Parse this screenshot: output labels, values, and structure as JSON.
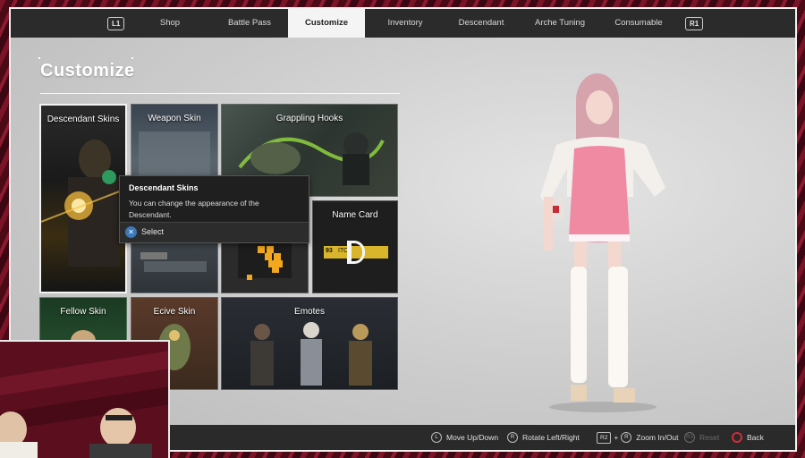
{
  "nav": {
    "left_key": "L1",
    "right_key": "R1",
    "tabs": [
      {
        "label": "Shop"
      },
      {
        "label": "Battle Pass"
      },
      {
        "label": "Customize"
      },
      {
        "label": "Inventory"
      },
      {
        "label": "Descendant"
      },
      {
        "label": "Arche Tuning"
      },
      {
        "label": "Consumable"
      }
    ],
    "active_tab": "Customize"
  },
  "page": {
    "title": "Customize"
  },
  "tiles": [
    {
      "label": "Descendant Skins"
    },
    {
      "label": "Weapon Skin"
    },
    {
      "label": "Grappling Hooks"
    },
    {
      "label": "Name Card"
    },
    {
      "label": "Fellow Skin"
    },
    {
      "label": "Ecive Skin"
    },
    {
      "label": "Emotes"
    }
  ],
  "name_card_preview": {
    "level": "93",
    "tag": "ITO"
  },
  "tooltip": {
    "title": "Descendant Skins",
    "body": "You can change the appearance of the Descendant.",
    "action_label": "Select",
    "action_button": "cross-button-icon"
  },
  "hints": [
    {
      "label": "Move Up/Down",
      "icon": "left-stick-icon"
    },
    {
      "label": "Rotate Left/Right",
      "icon": "right-stick-icon"
    },
    {
      "label": "Zoom In/Out",
      "icon": "r2-plus-stick-icon",
      "key": "R2"
    },
    {
      "label": "Reset",
      "icon": "r3-icon",
      "key": "R3",
      "disabled": true
    },
    {
      "label": "Back",
      "icon": "circle-button-icon"
    }
  ],
  "colors": {
    "nav_bg": "#2b2b2b",
    "active_tab_bg": "#f4f4f4",
    "back_button": "#d22d3a",
    "select_button": "#3c78b8"
  }
}
